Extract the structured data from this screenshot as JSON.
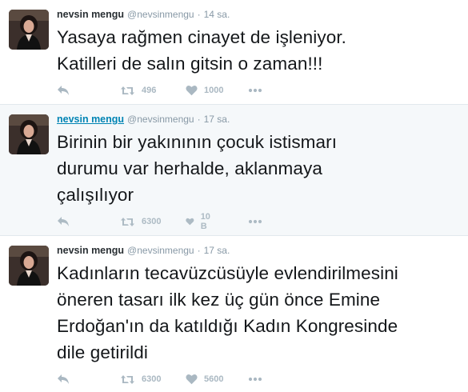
{
  "colors": {
    "name_link": "#0084b4",
    "meta": "#8899a6",
    "action_icon": "#aab8c2",
    "text": "#14171a",
    "highlight_bg": "#f5f8fa"
  },
  "tweets": [
    {
      "fullname": "nevsin mengu",
      "username": "@nevsinmengu",
      "separator": "·",
      "time": "14 sa.",
      "text_lines": [
        "Yasaya rağmen cinayet de işleniyor.",
        "Katilleri de salın gitsin o zaman!!!"
      ],
      "retweet_count": "496",
      "like_count": "1000",
      "icons": [
        "reply-icon",
        "retweet-icon",
        "heart-icon",
        "more-icon"
      ]
    },
    {
      "fullname": "nevsin mengu",
      "username": "@nevsinmengu",
      "separator": "·",
      "time": "17 sa.",
      "text_lines": [
        "Birinin bir yakınının çocuk istismarı",
        "durumu var herhalde, aklanmaya",
        "çalışılıyor"
      ],
      "retweet_count": "6300",
      "like_count": "10 B",
      "icons": [
        "reply-icon",
        "retweet-icon",
        "heart-icon",
        "more-icon"
      ]
    },
    {
      "fullname": "nevsin mengu",
      "username": "@nevsinmengu",
      "separator": "·",
      "time": "17 sa.",
      "text_lines": [
        "Kadınların tecavüzcüsüyle evlendirilmesini",
        "öneren tasarı ilk kez üç gün önce Emine",
        "Erdoğan'ın da katıldığı Kadın Kongresinde",
        "dile getirildi"
      ],
      "retweet_count": "6300",
      "like_count": "5600",
      "icons": [
        "reply-icon",
        "retweet-icon",
        "heart-icon",
        "more-icon"
      ]
    }
  ]
}
